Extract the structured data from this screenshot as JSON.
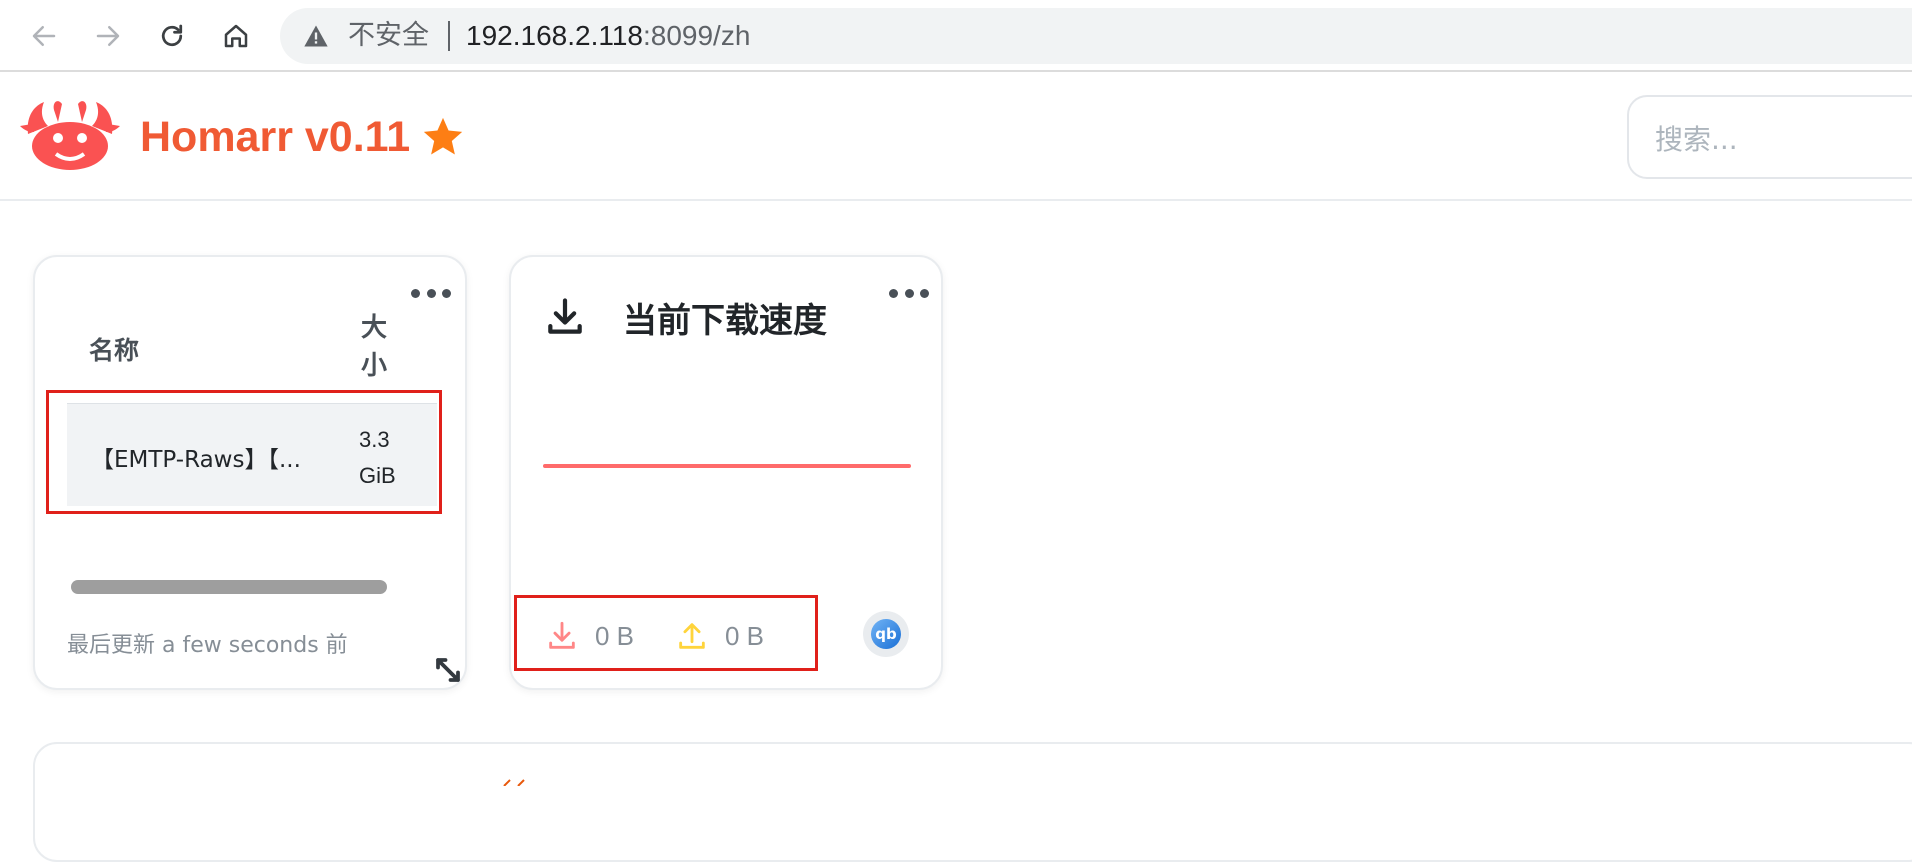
{
  "browser": {
    "security_label": "不安全",
    "url_host": "192.168.2.118",
    "url_path": ":8099/zh"
  },
  "header": {
    "title": "Homarr v0.11",
    "search_placeholder": "搜索..."
  },
  "torrent_widget": {
    "columns": {
      "name": "名称",
      "size": "大小"
    },
    "rows": [
      {
        "name": "【EMTP-Raws】【...",
        "size": "3.3 GiB"
      }
    ],
    "updated": "最后更新 a few seconds 前"
  },
  "speed_widget": {
    "title": "当前下载速度",
    "download": "0 B",
    "upload": "0 B",
    "client_badge": "qb",
    "colors": {
      "line": "#ff6b6b",
      "download_icon": "#ff8787",
      "upload_icon": "#ffd43b"
    }
  },
  "colors": {
    "brand": "#f05a34",
    "star": "#fd7e14",
    "highlight": "#e0201a"
  }
}
